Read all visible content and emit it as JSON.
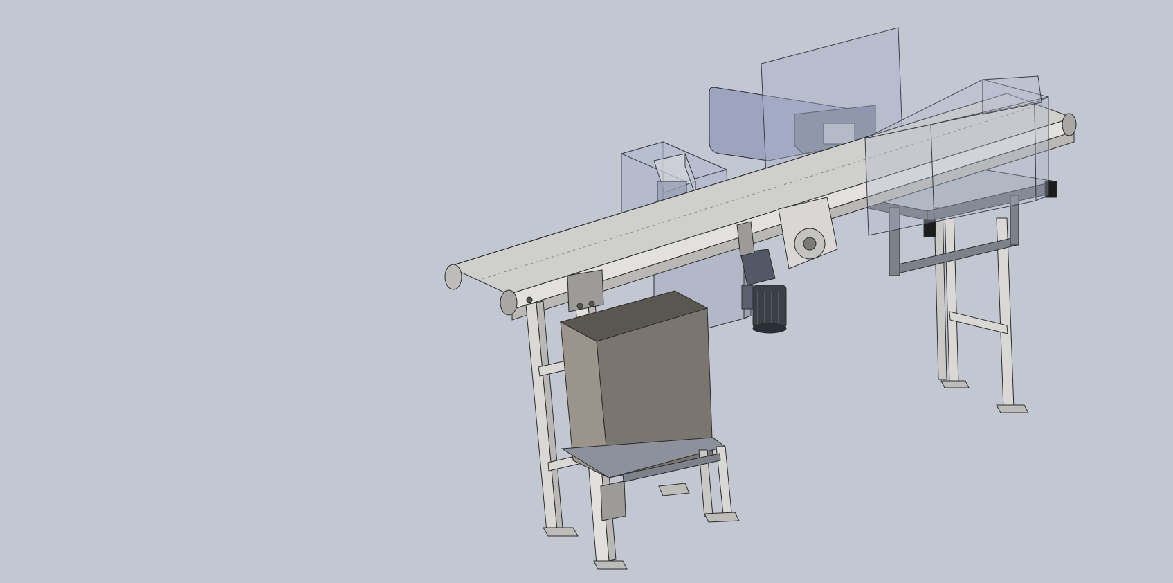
{
  "viewport": {
    "background": "#c3c7d2",
    "accent_line": "#2b2b2b"
  },
  "model": {
    "colors": {
      "frame": "#d9d8d4",
      "frame_shadow": "#a9a8a4",
      "belt": "#cfcfcc",
      "glass": "#a9b1c8",
      "glass_edge": "#3a3d46",
      "box_front": "#7a756f",
      "box_side": "#9a948c",
      "box_top": "#5a5650",
      "motor": "#3b4048",
      "cabinet": "#b3b8c8"
    },
    "icons": [
      "conveyor-icon",
      "motor-icon",
      "carton-icon",
      "sensor-hood-icon"
    ]
  }
}
